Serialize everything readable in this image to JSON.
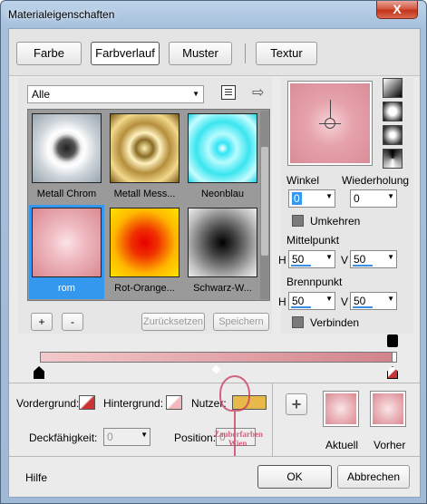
{
  "window": {
    "title": "Materialeigenschaften",
    "close_glyph": "X"
  },
  "tabs": [
    {
      "label": "Farbe"
    },
    {
      "label": "Farbverlauf"
    },
    {
      "label": "Muster"
    },
    {
      "label": "Textur"
    }
  ],
  "filter": {
    "selected": "Alle"
  },
  "gradients": [
    {
      "name": "Metall Chrom"
    },
    {
      "name": "Metall Mess..."
    },
    {
      "name": "Neonblau"
    },
    {
      "name": "rom"
    },
    {
      "name": "Rot-Orange..."
    },
    {
      "name": "Schwarz-W..."
    }
  ],
  "library_buttons": {
    "add": "+",
    "remove": "-",
    "reset": "Zurücksetzen",
    "save": "Speichern"
  },
  "settings": {
    "angle_label": "Winkel",
    "angle_value": "0",
    "repeat_label": "Wiederholung",
    "repeat_value": "0",
    "invert_label": "Umkehren",
    "center_label": "Mittelpunkt",
    "center_h_label": "H",
    "center_h": "50",
    "center_v_label": "V",
    "center_v": "50",
    "focus_label": "Brennpunkt",
    "focus_h_label": "H",
    "focus_h": "50",
    "focus_v_label": "V",
    "focus_v": "50",
    "link_label": "Verbinden"
  },
  "editor": {
    "foreground_label": "Vordergrund:",
    "background_label": "Hintergrund:",
    "user_label": "Nutzer:",
    "opacity_label": "Deckfähigkeit:",
    "opacity_value": "0",
    "position_label": "Position:",
    "position_value": "0"
  },
  "compare": {
    "current_label": "Aktuell",
    "previous_label": "Vorher",
    "add": "+"
  },
  "footer": {
    "help": "Hilfe",
    "ok": "OK",
    "cancel": "Abbrechen"
  },
  "watermark": {
    "line1": "Zauberfarben",
    "line2": "Wien"
  },
  "colors": {
    "accent": "#3398ee",
    "gradient_start": "#f3c9cc",
    "gradient_end": "#d2838b"
  }
}
